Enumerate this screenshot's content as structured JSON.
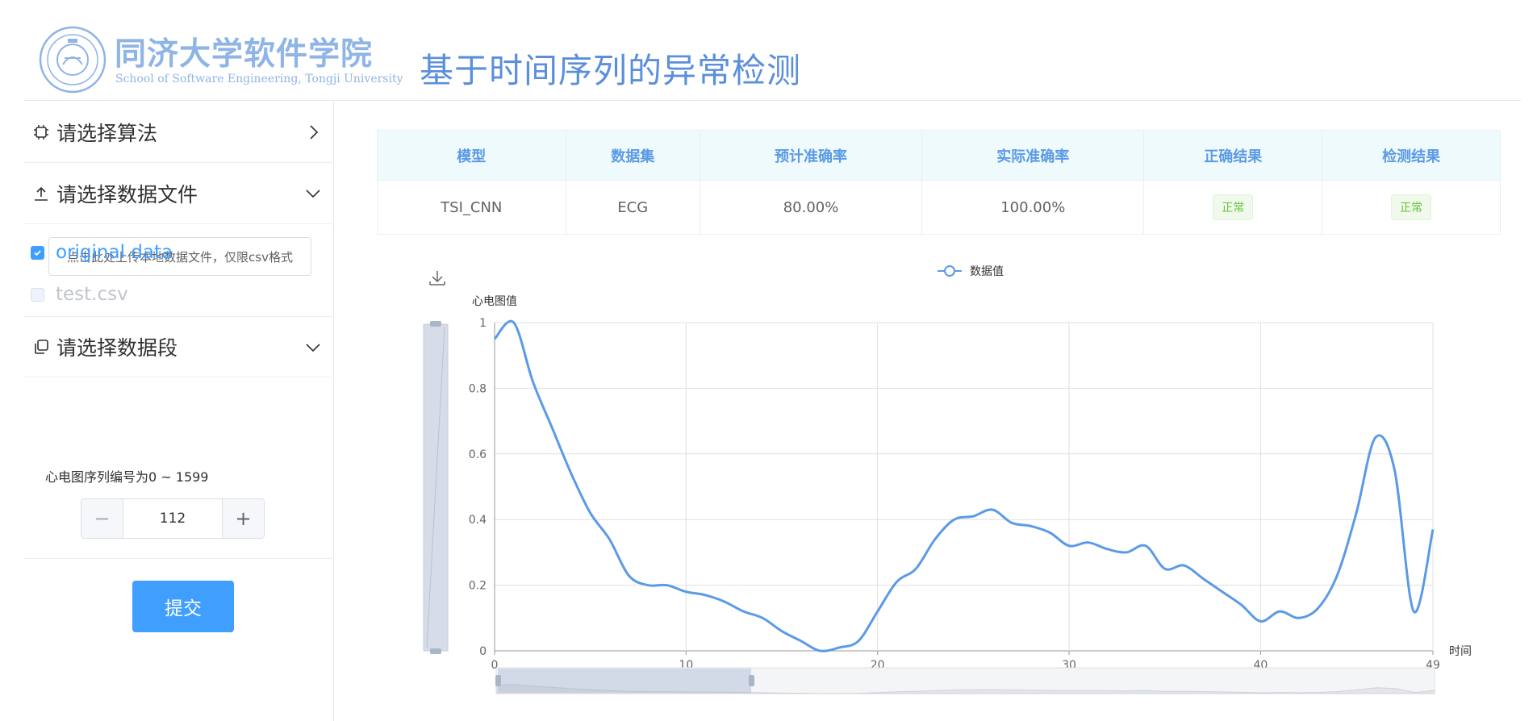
{
  "header": {
    "logo_cn": "同济大学软件学院",
    "logo_en": "School of Software Engineering, Tongji University",
    "page_title": "基于时间序列的异常检测"
  },
  "sidebar": {
    "algorithm_label": "请选择算法",
    "data_file_label": "请选择数据文件",
    "upload_text": "点击此处上传本地数据文件，仅限csv格式",
    "files": [
      {
        "name": "original data",
        "checked": true
      },
      {
        "name": "test.csv",
        "checked": false
      }
    ],
    "segment_label": "请选择数据段",
    "range_text": "心电图序列编号为0 ~ 1599",
    "stepper": {
      "minus": "−",
      "value": "112",
      "plus": "+"
    },
    "submit_label": "提交"
  },
  "table": {
    "headers": [
      "模型",
      "数据集",
      "预计准确率",
      "实际准确率",
      "正确结果",
      "检测结果"
    ],
    "row": [
      "TSI_CNN",
      "ECG",
      "80.00%",
      "100.00%",
      "正常",
      "正常"
    ]
  },
  "colors": {
    "accent": "#409eff",
    "line": "#5b9ae6",
    "success": "#67c23a"
  },
  "chart_data": {
    "type": "line",
    "legend": "数据值",
    "ylabel": "心电图值",
    "xlabel": "时间",
    "xlim": [
      0,
      49
    ],
    "ylim": [
      0,
      1
    ],
    "x_ticks": [
      "0",
      "10",
      "20",
      "30",
      "40",
      "49"
    ],
    "y_ticks": [
      "0",
      "0.2",
      "0.4",
      "0.6",
      "0.8",
      "1"
    ],
    "series": [
      {
        "name": "数据值",
        "x": [
          0,
          1,
          2,
          3,
          4,
          5,
          6,
          7,
          8,
          9,
          10,
          11,
          12,
          13,
          14,
          15,
          16,
          17,
          18,
          19,
          20,
          21,
          22,
          23,
          24,
          25,
          26,
          27,
          28,
          29,
          30,
          31,
          32,
          33,
          34,
          35,
          36,
          37,
          38,
          39,
          40,
          41,
          42,
          43,
          44,
          45,
          46,
          47,
          48,
          49
        ],
        "values": [
          0.95,
          1.0,
          0.82,
          0.68,
          0.54,
          0.42,
          0.34,
          0.23,
          0.2,
          0.2,
          0.18,
          0.17,
          0.15,
          0.12,
          0.1,
          0.06,
          0.03,
          0.0,
          0.01,
          0.03,
          0.12,
          0.21,
          0.25,
          0.34,
          0.4,
          0.41,
          0.43,
          0.39,
          0.38,
          0.36,
          0.32,
          0.33,
          0.31,
          0.3,
          0.32,
          0.25,
          0.26,
          0.22,
          0.18,
          0.14,
          0.09,
          0.12,
          0.1,
          0.13,
          0.23,
          0.42,
          0.65,
          0.55,
          0.12,
          0.37
        ]
      }
    ],
    "grid": true,
    "legend_position": "top-center",
    "y_zoom_slider": true,
    "x_zoom_slider": true,
    "x_zoom_selected_fraction": 0.27
  }
}
